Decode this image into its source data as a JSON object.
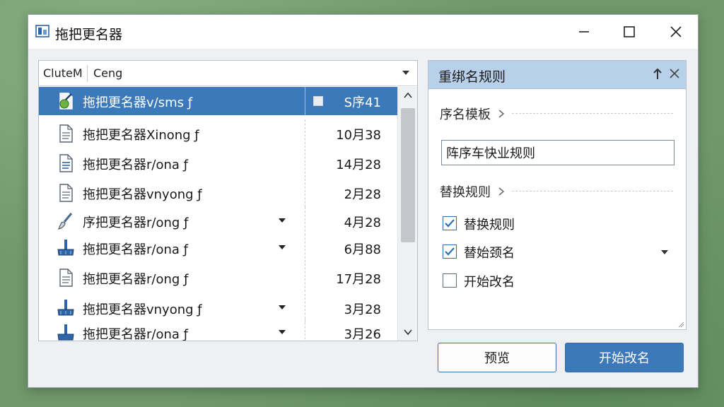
{
  "window": {
    "title": "拖把更名器"
  },
  "list": {
    "header": {
      "col1": "CluteM",
      "col2": "Ceng"
    },
    "rows": [
      {
        "name": "拖把更名器v/sms ƒ",
        "date": "S序41",
        "icon": "file-edit-icon",
        "selected": true,
        "has_dropdown": false
      },
      {
        "name": "拖把更名器Xinong ƒ",
        "date": "10月38",
        "icon": "document-icon",
        "selected": false,
        "has_dropdown": false
      },
      {
        "name": "拖把更名器r/ona ƒ",
        "date": "14月28",
        "icon": "text-document-icon",
        "selected": false,
        "has_dropdown": false
      },
      {
        "name": "拖把更名器vnyong ƒ",
        "date": "2月28",
        "icon": "document-icon",
        "selected": false,
        "has_dropdown": false
      },
      {
        "name": "序把更名器r/ong ƒ",
        "date": "4月28",
        "icon": "brush-icon",
        "selected": false,
        "has_dropdown": true
      },
      {
        "name": "拖把更名器r/ona ƒ",
        "date": "6月88",
        "icon": "mop-icon",
        "selected": false,
        "has_dropdown": true
      },
      {
        "name": "拖把更名器r/ong ƒ",
        "date": "17月28",
        "icon": "document-icon",
        "selected": false,
        "has_dropdown": false
      },
      {
        "name": "拖把更名器vnyong ƒ",
        "date": "3月28",
        "icon": "mop-icon",
        "selected": false,
        "has_dropdown": true
      },
      {
        "name": "拖把更名器r/ona ƒ",
        "date": "3月26",
        "icon": "mop-icon",
        "selected": false,
        "has_dropdown": true
      }
    ]
  },
  "rules_panel": {
    "title": "重绑名规则",
    "template_section": "序名模板",
    "template_value": "阵序车快业规则",
    "replace_section": "替换规则",
    "options": [
      {
        "label": "替换规则",
        "checked": true,
        "has_dropdown": false
      },
      {
        "label": "替始颈名",
        "checked": true,
        "has_dropdown": true
      },
      {
        "label": "开始改名",
        "checked": false,
        "has_dropdown": false
      }
    ]
  },
  "buttons": {
    "preview": "预览",
    "start": "开始改名"
  },
  "colors": {
    "accent": "#3b79ba",
    "panel_header": "#b9d0ea",
    "background": "#70996b"
  }
}
